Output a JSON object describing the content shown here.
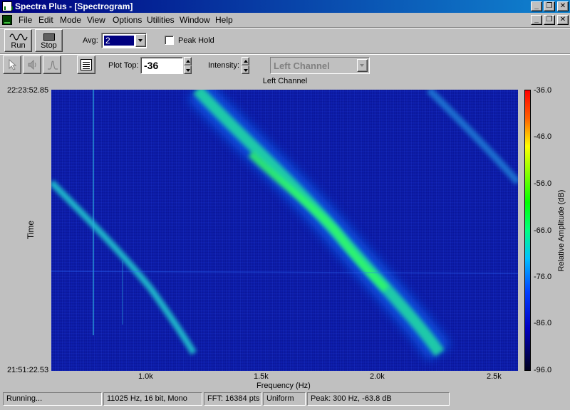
{
  "window": {
    "title": "Spectra Plus - [Spectrogram]",
    "caption_buttons": [
      "minimize-icon",
      "restore-icon",
      "close-icon"
    ],
    "caption_glyphs": [
      "_",
      "❐",
      "✕"
    ]
  },
  "menu": {
    "items": [
      {
        "label": "File"
      },
      {
        "label": "Edit"
      },
      {
        "label": "Mode"
      },
      {
        "label": "View"
      },
      {
        "label": "Options"
      },
      {
        "label": "Utilities"
      },
      {
        "label": "Window"
      },
      {
        "label": "Help"
      }
    ]
  },
  "toolbar1": {
    "run_label": "Run",
    "stop_label": "Stop",
    "avg_label": "Avg:",
    "avg_value": "2",
    "peak_hold_label": "Peak Hold",
    "peak_hold_checked": false
  },
  "toolbar2": {
    "plot_top_label": "Plot Top:",
    "plot_top_value": "-36",
    "intensity_label": "Intensity:",
    "channel_value": "Left Channel"
  },
  "plot": {
    "title": "Left Channel",
    "time_top": "22:23:52.85",
    "time_bottom": "21:51:22.53",
    "y_label": "Time",
    "x_label": "Frequency (Hz)",
    "x_ticks": [
      "1.0k",
      "1.5k",
      "2.0k",
      "2.5k"
    ],
    "colorbar_label": "Relative Amplitude (dB)",
    "colorbar_ticks": [
      "-36.0",
      "-46.0",
      "-56.0",
      "-66.0",
      "-76.0",
      "-86.0",
      "-96.0"
    ]
  },
  "chart_data": {
    "type": "heatmap",
    "title": "Left Channel",
    "xlabel": "Frequency (Hz)",
    "ylabel": "Time",
    "x_tick_values": [
      1000,
      1500,
      2000,
      2500
    ],
    "y_range": [
      "21:51:22.53",
      "22:23:52.85"
    ],
    "z_label": "Relative Amplitude (dB)",
    "z_range": [
      -96.0,
      -36.0
    ],
    "colormap": [
      "#000020",
      "#0000c0",
      "#0040ff",
      "#00c0ff",
      "#00ff80",
      "#00ff00",
      "#80ff00",
      "#ffff00",
      "#ff6000",
      "#ff0000"
    ]
  },
  "status": {
    "state": "Running...",
    "format": "11025 Hz, 16 bit, Mono",
    "fft": "FFT: 16384 pts",
    "window": "Uniform",
    "peak": "Peak: 300 Hz, -63.8 dB"
  }
}
